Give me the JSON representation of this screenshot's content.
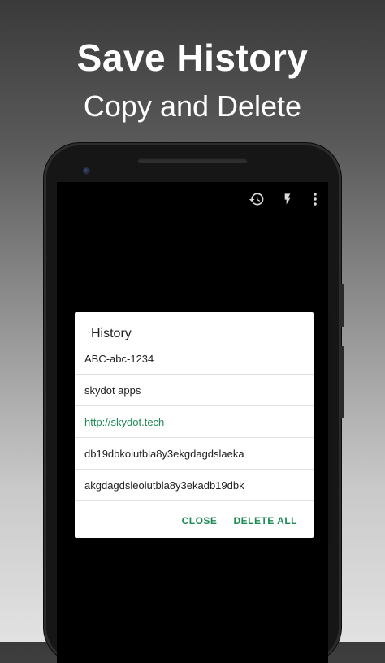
{
  "headline": {
    "title": "Save History",
    "subtitle": "Copy and Delete"
  },
  "toolbar": {
    "icons": [
      "history-icon",
      "flash-icon",
      "more-vert-icon"
    ]
  },
  "dialog": {
    "title": "History",
    "items": [
      {
        "text": "ABC-abc-1234",
        "is_link": false
      },
      {
        "text": "skydot apps",
        "is_link": false
      },
      {
        "text": "http://skydot.tech",
        "is_link": true
      },
      {
        "text": "db19dbkoiutbla8y3ekgdagdslaeka",
        "is_link": false
      },
      {
        "text": "akgdagdsleoiutbla8y3ekadb19dbk",
        "is_link": false
      }
    ],
    "close_label": "CLOSE",
    "delete_all_label": "DELETE ALL"
  },
  "colors": {
    "accent": "#1e8a55",
    "dialog_bg": "#ffffff",
    "screen_bg": "#000000"
  }
}
